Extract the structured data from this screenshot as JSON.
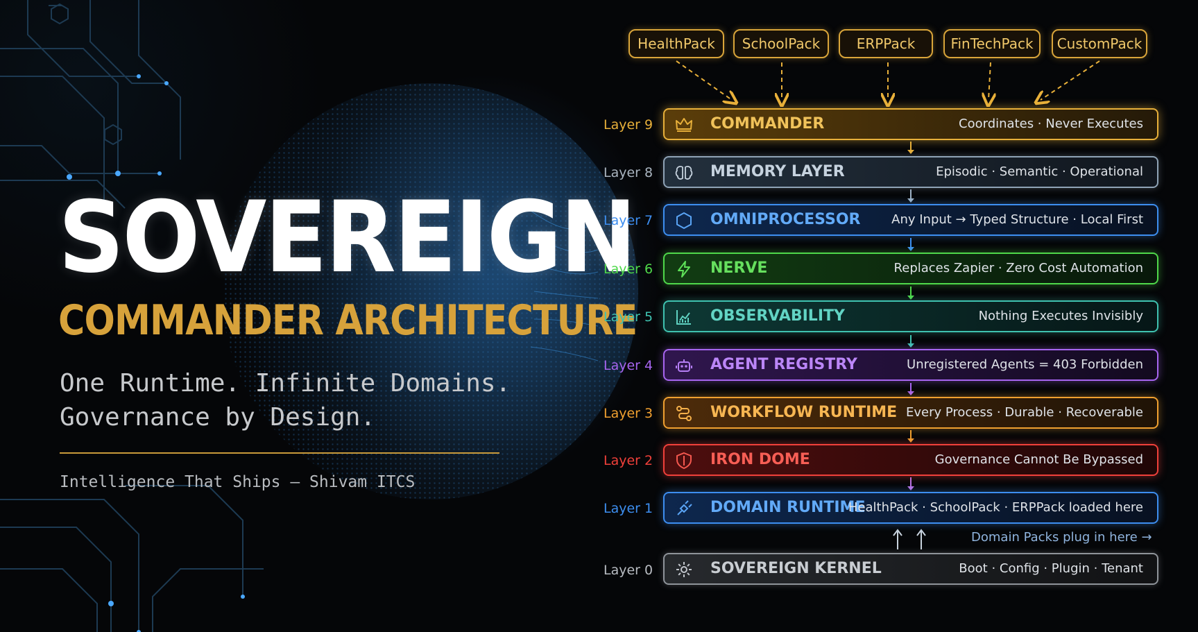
{
  "hero": {
    "title": "SOVEREIGN",
    "subtitle": "COMMANDER ARCHITECTURE",
    "tagline_line1": "One Runtime. Infinite Domains.",
    "tagline_line2": "Governance by Design.",
    "credit": "Intelligence That Ships – Shivam ITCS"
  },
  "packs": [
    "HealthPack",
    "SchoolPack",
    "ERPPack",
    "FinTechPack",
    "CustomPack"
  ],
  "layers": [
    {
      "label": "Layer 9",
      "name": "COMMANDER",
      "desc": "Coordinates · Never Executes",
      "color": "#e8b03a",
      "icon": "crown-icon"
    },
    {
      "label": "Layer 8",
      "name": "MEMORY LAYER",
      "desc": "Episodic · Semantic · Operational",
      "color": "#9fb3c6",
      "icon": "brain-icon"
    },
    {
      "label": "Layer 7",
      "name": "OMNIPROCESSOR",
      "desc": "Any Input → Typed Structure · Local First",
      "color": "#3d8ef0",
      "icon": "hexagon-icon"
    },
    {
      "label": "Layer 6",
      "name": "NERVE",
      "desc": "Replaces Zapier · Zero Cost Automation",
      "color": "#4fd84a",
      "icon": "lightning-icon"
    },
    {
      "label": "Layer 5",
      "name": "OBSERVABILITY",
      "desc": "Nothing Executes Invisibly",
      "color": "#3fc2b0",
      "icon": "chart-icon"
    },
    {
      "label": "Layer 4",
      "name": "AGENT REGISTRY",
      "desc": "Unregistered Agents = 403 Forbidden",
      "color": "#a765f0",
      "icon": "robot-icon"
    },
    {
      "label": "Layer 3",
      "name": "WORKFLOW RUNTIME",
      "desc": "Every Process · Durable · Recoverable",
      "color": "#f0a030",
      "icon": "workflow-icon"
    },
    {
      "label": "Layer 2",
      "name": "IRON DOME",
      "desc": "Governance Cannot Be Bypassed",
      "color": "#f0403a",
      "icon": "shield-icon"
    },
    {
      "label": "Layer 1",
      "name": "DOMAIN RUNTIME",
      "desc": "HealthPack · SchoolPack · ERPPack loaded here",
      "color": "#3d8ef0",
      "icon": "plug-icon"
    },
    {
      "label": "Layer 0",
      "name": "SOVEREIGN KERNEL",
      "desc": "Boot · Config · Plugin · Tenant",
      "color": "#a8acb2",
      "icon": "gear-icon"
    }
  ],
  "plug_note": "Domain Packs plug in here →",
  "colors": {
    "gold": "#d7a23b",
    "background": "#050608"
  }
}
